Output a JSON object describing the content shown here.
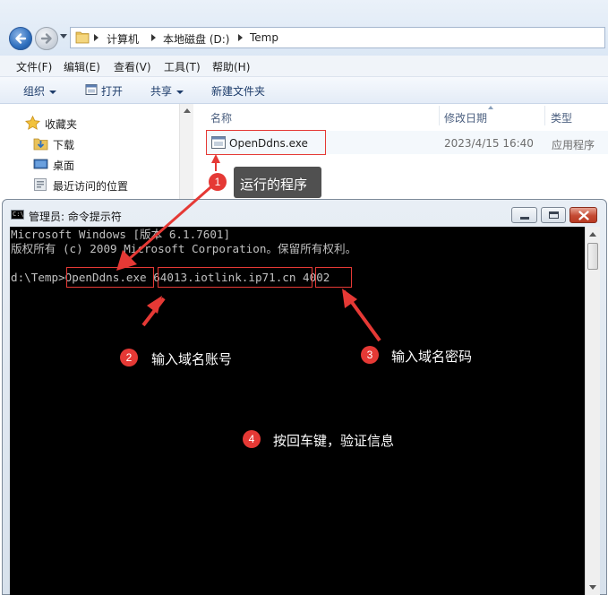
{
  "address": {
    "crumbs": [
      "计算机",
      "本地磁盘 (D:)",
      "Temp"
    ]
  },
  "menubar": {
    "items": [
      "文件(F)",
      "编辑(E)",
      "查看(V)",
      "工具(T)",
      "帮助(H)"
    ]
  },
  "toolbar": {
    "organize": "组织",
    "open": "打开",
    "share": "共享",
    "new_folder": "新建文件夹"
  },
  "nav_pane": {
    "items": [
      {
        "label": "收藏夹",
        "icon": "star-icon"
      },
      {
        "label": "下载",
        "icon": "downloads-folder-icon"
      },
      {
        "label": "桌面",
        "icon": "desktop-icon"
      },
      {
        "label": "最近访问的位置",
        "icon": "recent-places-icon"
      }
    ]
  },
  "file_list": {
    "columns": [
      "名称",
      "修改日期",
      "类型"
    ],
    "rows": [
      {
        "name": "OpenDdns.exe",
        "modified": "2023/4/15 16:40",
        "type": "应用程序",
        "icon": "exe-file-icon"
      }
    ]
  },
  "cmd": {
    "title": "管理员: 命令提示符",
    "icon_text": "C:\\",
    "lines": [
      "Microsoft Windows [版本 6.1.7601]",
      "版权所有 (c) 2009 Microsoft Corporation。保留所有权利。",
      "",
      "d:\\Temp>OpenDdns.exe 64013.iotlink.ip71.cn 4002"
    ]
  },
  "annotations": [
    {
      "number": "1",
      "text": "运行的程序"
    },
    {
      "number": "2",
      "text": "输入域名账号"
    },
    {
      "number": "3",
      "text": "输入域名密码"
    },
    {
      "number": "4",
      "text": "按回车键，验证信息"
    }
  ],
  "colors": {
    "annotation_red": "#e53935",
    "console_bg": "#000000",
    "console_text": "#c0c0c0",
    "callout_bg": "#505050"
  }
}
